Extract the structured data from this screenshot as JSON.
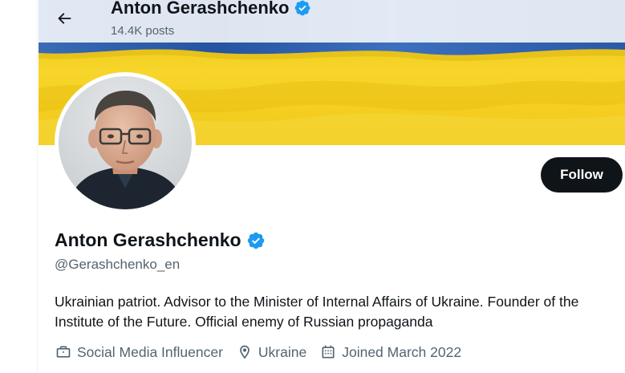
{
  "header": {
    "name": "Anton Gerashchenko",
    "post_count": "14.4K posts"
  },
  "profile": {
    "display_name": "Anton Gerashchenko",
    "handle": "@Gerashchenko_en",
    "bio": "Ukrainian patriot. Advisor to the Minister of Internal Affairs of Ukraine. Founder of the Institute of the Future. Official enemy of Russian propaganda",
    "category": "Social Media Influencer",
    "location": "Ukraine",
    "joined": "Joined March 2022",
    "follow_label": "Follow"
  },
  "icons": {
    "back": "arrow-left-icon",
    "verified": "verified-badge-icon",
    "category": "briefcase-icon",
    "location": "location-pin-icon",
    "joined": "calendar-icon"
  },
  "colors": {
    "verified": "#1d9bf0",
    "flag_blue": "#2f5fa8",
    "flag_yellow": "#f2cd1c",
    "text_secondary": "#536471",
    "follow_bg": "#0f1419"
  }
}
